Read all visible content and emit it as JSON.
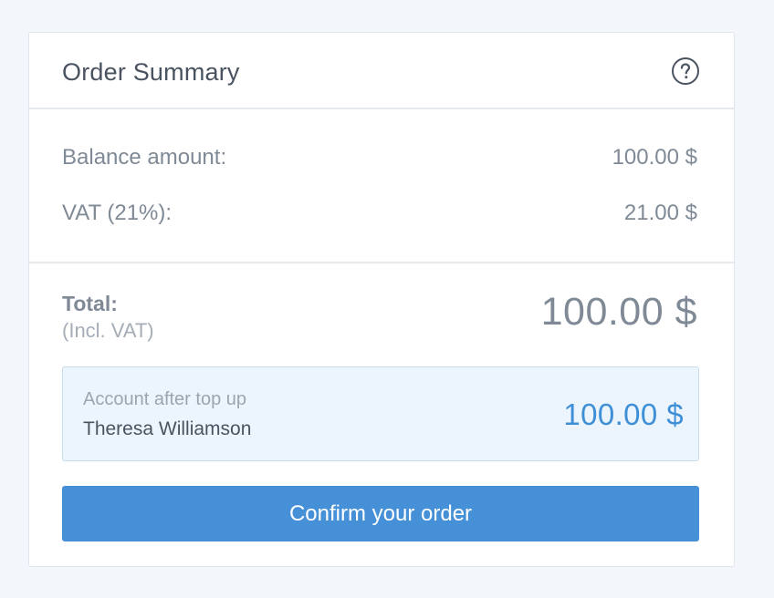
{
  "header": {
    "title": "Order Summary",
    "help_icon": "question-circle-icon"
  },
  "lines": [
    {
      "label": "Balance amount:",
      "value": "100.00 $"
    },
    {
      "label": "VAT (21%):",
      "value": "21.00 $"
    }
  ],
  "total": {
    "label": "Total:",
    "sublabel": "(Incl. VAT)",
    "amount": "100.00 $"
  },
  "account": {
    "label": "Account after top up",
    "name": "Theresa Williamson",
    "amount": "100.00 $"
  },
  "confirm_label": "Confirm your order",
  "colors": {
    "accent": "#4590d6",
    "account_amount": "#3f8fd6",
    "account_bg": "#ecf5fd",
    "page_bg": "#f3f7fc"
  }
}
